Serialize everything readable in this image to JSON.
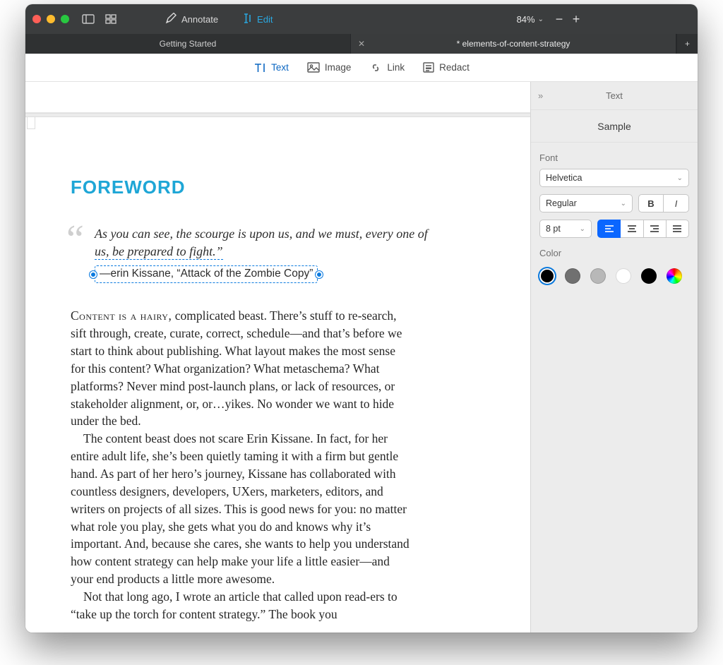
{
  "toolbar": {
    "annotate": "Annotate",
    "edit": "Edit",
    "zoom": "84%"
  },
  "tabs": {
    "left": "Getting Started",
    "right": "* elements-of-content-strategy"
  },
  "edittools": {
    "text": "Text",
    "image": "Image",
    "link": "Link",
    "redact": "Redact"
  },
  "doc": {
    "heading": "FOREWORD",
    "quote_line1": "As you can see, the scourge is upon us, and we must, every one of",
    "quote_line2": "us, be prepared to fight.”",
    "attribution": "—erin Kissane, “Attack of the Zombie Copy”",
    "para1_lead": "Content is a hairy,",
    "para1_rest": " complicated beast. There’s stuff to re-search, sift through, create, curate, correct, schedule—and that’s before we start to think about publishing. What layout makes the most sense for this content? What organization? What metaschema? What platforms? Never mind post-launch plans, or lack of resources, or stakeholder alignment, or, or…yikes. No wonder we want to hide under the bed.",
    "para2": "The content beast does not scare Erin Kissane. In fact, for her entire adult life, she’s been quietly taming it with a firm but gentle hand. As part of her hero’s journey, Kissane has collaborated with countless designers, developers, UXers, marketers, editors, and writers on projects of all sizes. This is good news for you: no matter what role you play, she gets what you do and knows why it’s important. And, because she cares, she wants to help you understand how content strategy can help make your life a little easier—and your end products a little more awesome.",
    "para3": "Not that long ago, I wrote an article that called upon read-ers to “take up the torch for content strategy.” The book you"
  },
  "sidebar": {
    "title": "Text",
    "sample": "Sample",
    "font_label": "Font",
    "font_family": "Helvetica",
    "font_style": "Regular",
    "bold": "B",
    "italic": "I",
    "size": "8 pt",
    "color_label": "Color",
    "colors": [
      "#000000",
      "#707070",
      "#b8b8b8",
      "#ffffff",
      "#000000"
    ]
  }
}
